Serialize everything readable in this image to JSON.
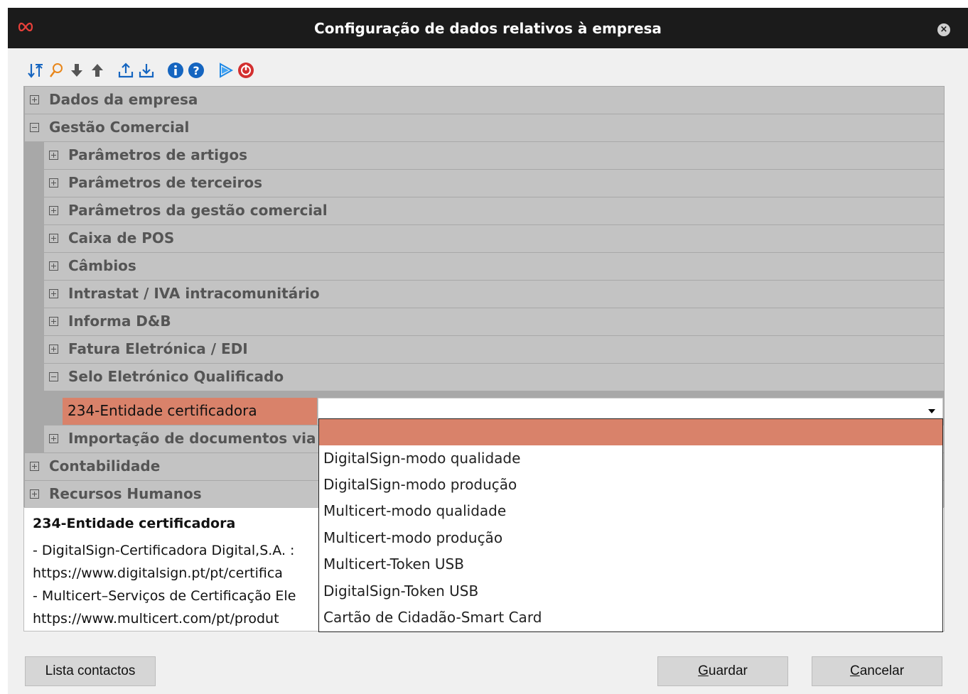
{
  "window": {
    "title": "Configuração de dados relativos à empresa"
  },
  "toolbar": {
    "icons": [
      "sort-icon",
      "search-icon",
      "arrow-down-icon",
      "arrow-up-icon",
      "export-icon",
      "import-icon",
      "info-icon",
      "help-icon",
      "play-icon",
      "stop-icon"
    ],
    "colors": {
      "blue": "#1565c0",
      "orange": "#e8861a",
      "gray": "#555555",
      "red": "#d32f2f"
    }
  },
  "tree": {
    "items": [
      {
        "label": "Dados da empresa",
        "expanded": false
      },
      {
        "label": "Gestão Comercial",
        "expanded": true
      },
      {
        "label": "Parâmetros de artigos",
        "expanded": false
      },
      {
        "label": "Parâmetros de terceiros",
        "expanded": false
      },
      {
        "label": "Parâmetros da gestão comercial",
        "expanded": false
      },
      {
        "label": "Caixa de POS",
        "expanded": false
      },
      {
        "label": "Câmbios",
        "expanded": false
      },
      {
        "label": "Intrastat / IVA intracomunitário",
        "expanded": false
      },
      {
        "label": "Informa D&B",
        "expanded": false
      },
      {
        "label": "Fatura Eletrónica / EDI",
        "expanded": false
      },
      {
        "label": "Selo Eletrónico Qualificado",
        "expanded": true
      },
      {
        "label": "Importação de documentos via SA",
        "expanded": false
      },
      {
        "label": "Contabilidade",
        "expanded": false
      },
      {
        "label": "Recursos Humanos",
        "expanded": false
      }
    ],
    "property": {
      "name": "234-Entidade certificadora",
      "value": ""
    }
  },
  "dropdown": {
    "options": [
      "",
      "DigitalSign-modo qualidade",
      "DigitalSign-modo produção",
      "Multicert-modo qualidade",
      "Multicert-modo produção",
      "Multicert-Token USB",
      "DigitalSign-Token USB",
      "Cartão de Cidadão-Smart Card"
    ],
    "selected_index": 0
  },
  "description": {
    "title": "234-Entidade certificadora",
    "lines": [
      "- DigitalSign-Certificadora Digital,S.A. :",
      "https://www.digitalsign.pt/pt/certifica",
      "- Multicert–Serviços de Certificação Ele",
      "https://www.multicert.com/pt/produt"
    ]
  },
  "buttons": {
    "contacts": "Lista contactos",
    "save_first": "G",
    "save_rest": "uardar",
    "cancel_first": "C",
    "cancel_rest": "ancelar"
  },
  "colors": {
    "selected": "#d9826a",
    "titlebar": "#1b1b1b",
    "tree_row": "#c3c3c3"
  }
}
